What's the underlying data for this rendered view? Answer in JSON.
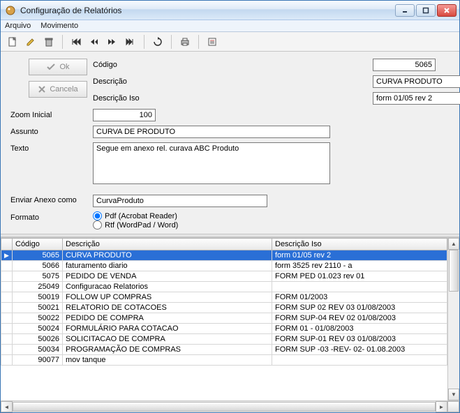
{
  "title": "Configuração de Relatórios",
  "menu": {
    "arquivo": "Arquivo",
    "movimento": "Movimento"
  },
  "buttons": {
    "ok": "Ok",
    "cancela": "Cancela"
  },
  "form": {
    "labels": {
      "codigo": "Código",
      "descricao": "Descrição",
      "descricao_iso": "Descrição Iso",
      "zoom": "Zoom Inicial",
      "assunto": "Assunto",
      "texto": "Texto",
      "enviar_anexo": "Enviar Anexo como",
      "formato": "Formato"
    },
    "values": {
      "codigo": "5065",
      "descricao": "CURVA PRODUTO",
      "descricao_iso": "form 01/05 rev 2",
      "zoom": "100",
      "assunto": "CURVA DE PRODUTO",
      "texto": "Segue em anexo rel. curava ABC Produto",
      "enviar_anexo": "CurvaProduto"
    },
    "formato_options": {
      "pdf": "Pdf (Acrobat Reader)",
      "rtf": "Rtf (WordPad / Word)"
    },
    "formato_selected": "pdf"
  },
  "grid": {
    "headers": {
      "codigo": "Código",
      "descricao": "Descrição",
      "descricao_iso": "Descrição Iso"
    },
    "rows": [
      {
        "codigo": "5065",
        "descricao": "CURVA PRODUTO",
        "descricao_iso": "form 01/05 rev 2",
        "selected": true
      },
      {
        "codigo": "5066",
        "descricao": "faturamento diario",
        "descricao_iso": "form 3525 rev 2110 - a"
      },
      {
        "codigo": "5075",
        "descricao": "PEDIDO DE VENDA",
        "descricao_iso": "FORM PED 01.023 rev 01"
      },
      {
        "codigo": "25049",
        "descricao": "Configuracao Relatorios",
        "descricao_iso": ""
      },
      {
        "codigo": "50019",
        "descricao": "FOLLOW UP COMPRAS",
        "descricao_iso": "FORM 01/2003"
      },
      {
        "codigo": "50021",
        "descricao": "RELATORIO DE COTACOES",
        "descricao_iso": "FORM SUP 02 REV 03 01/08/2003"
      },
      {
        "codigo": "50022",
        "descricao": "PEDIDO DE COMPRA",
        "descricao_iso": "FORM SUP-04 REV 02 01/08/2003"
      },
      {
        "codigo": "50024",
        "descricao": "FORMULÁRIO PARA COTACAO",
        "descricao_iso": "FORM 01 - 01/08/2003"
      },
      {
        "codigo": "50026",
        "descricao": "SOLICITACAO DE COMPRA",
        "descricao_iso": "FORM SUP-01 REV 03 01/08/2003"
      },
      {
        "codigo": "50034",
        "descricao": "PROGRAMAÇÃO DE COMPRAS",
        "descricao_iso": "FORM SUP -03 -REV- 02- 01.08.2003"
      },
      {
        "codigo": "90077",
        "descricao": "mov tanque",
        "descricao_iso": ""
      }
    ]
  }
}
